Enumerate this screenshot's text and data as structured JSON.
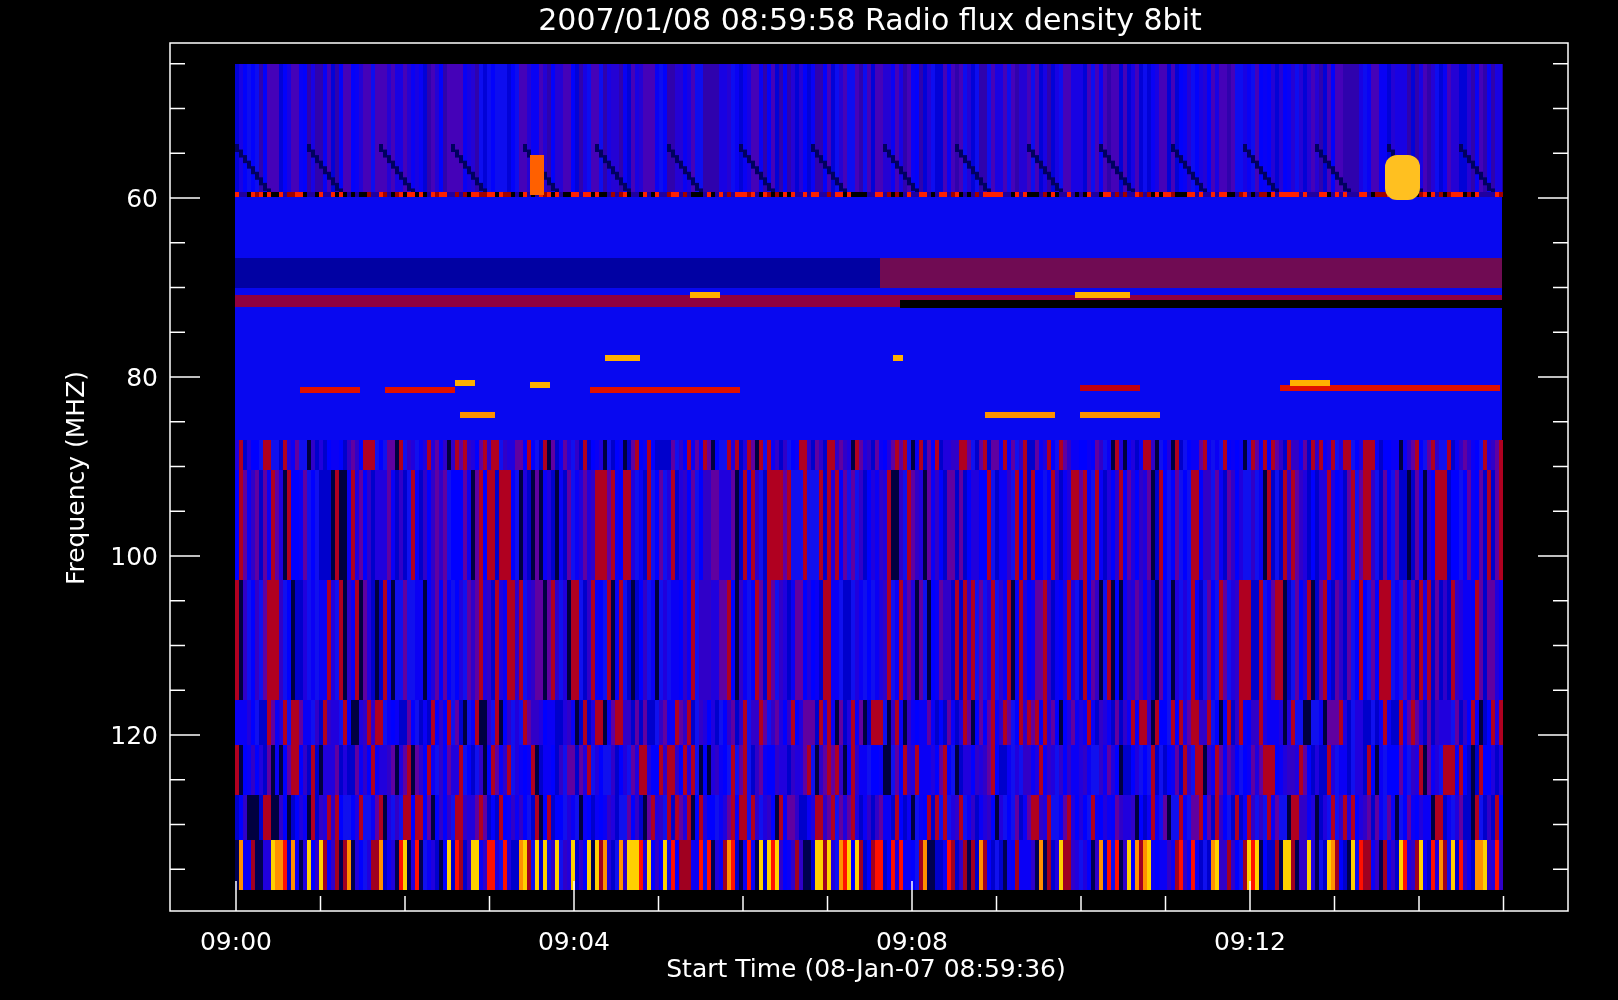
{
  "title": "2007/01/08 08:59:58 Radio flux density 8bit",
  "y_axis": {
    "label": "Frequency (MHZ)",
    "ticks": [
      "60",
      "80",
      "100",
      "120"
    ]
  },
  "x_axis": {
    "label": "Start Time (08-Jan-07 08:59:36)",
    "ticks": [
      "09:00",
      "09:04",
      "09:08",
      "09:12"
    ]
  }
}
